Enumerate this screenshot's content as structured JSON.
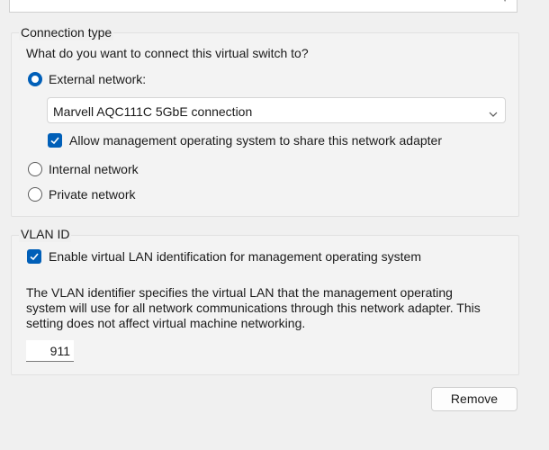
{
  "connection": {
    "legend": "Connection type",
    "question": "What do you want to connect this virtual switch to?",
    "options": [
      {
        "label": "External network:",
        "selected": true
      },
      {
        "label": "Internal network",
        "selected": false
      },
      {
        "label": "Private network",
        "selected": false
      }
    ],
    "adapter_value": "Marvell AQC111C 5GbE connection",
    "share_label": "Allow management operating system to share this network adapter",
    "share_checked": true
  },
  "vlan": {
    "legend": "VLAN ID",
    "enable_label": "Enable virtual LAN identification for management operating system",
    "enable_checked": true,
    "description_lines": [
      "The VLAN identifier specifies the virtual LAN that the management operating",
      "system will use for all network communications through this network adapter. This",
      "setting does not affect virtual machine networking."
    ],
    "id_value": "911"
  },
  "remove_label": "Remove",
  "colors": {
    "accent": "#005fb8",
    "background": "#f0f0f0"
  }
}
